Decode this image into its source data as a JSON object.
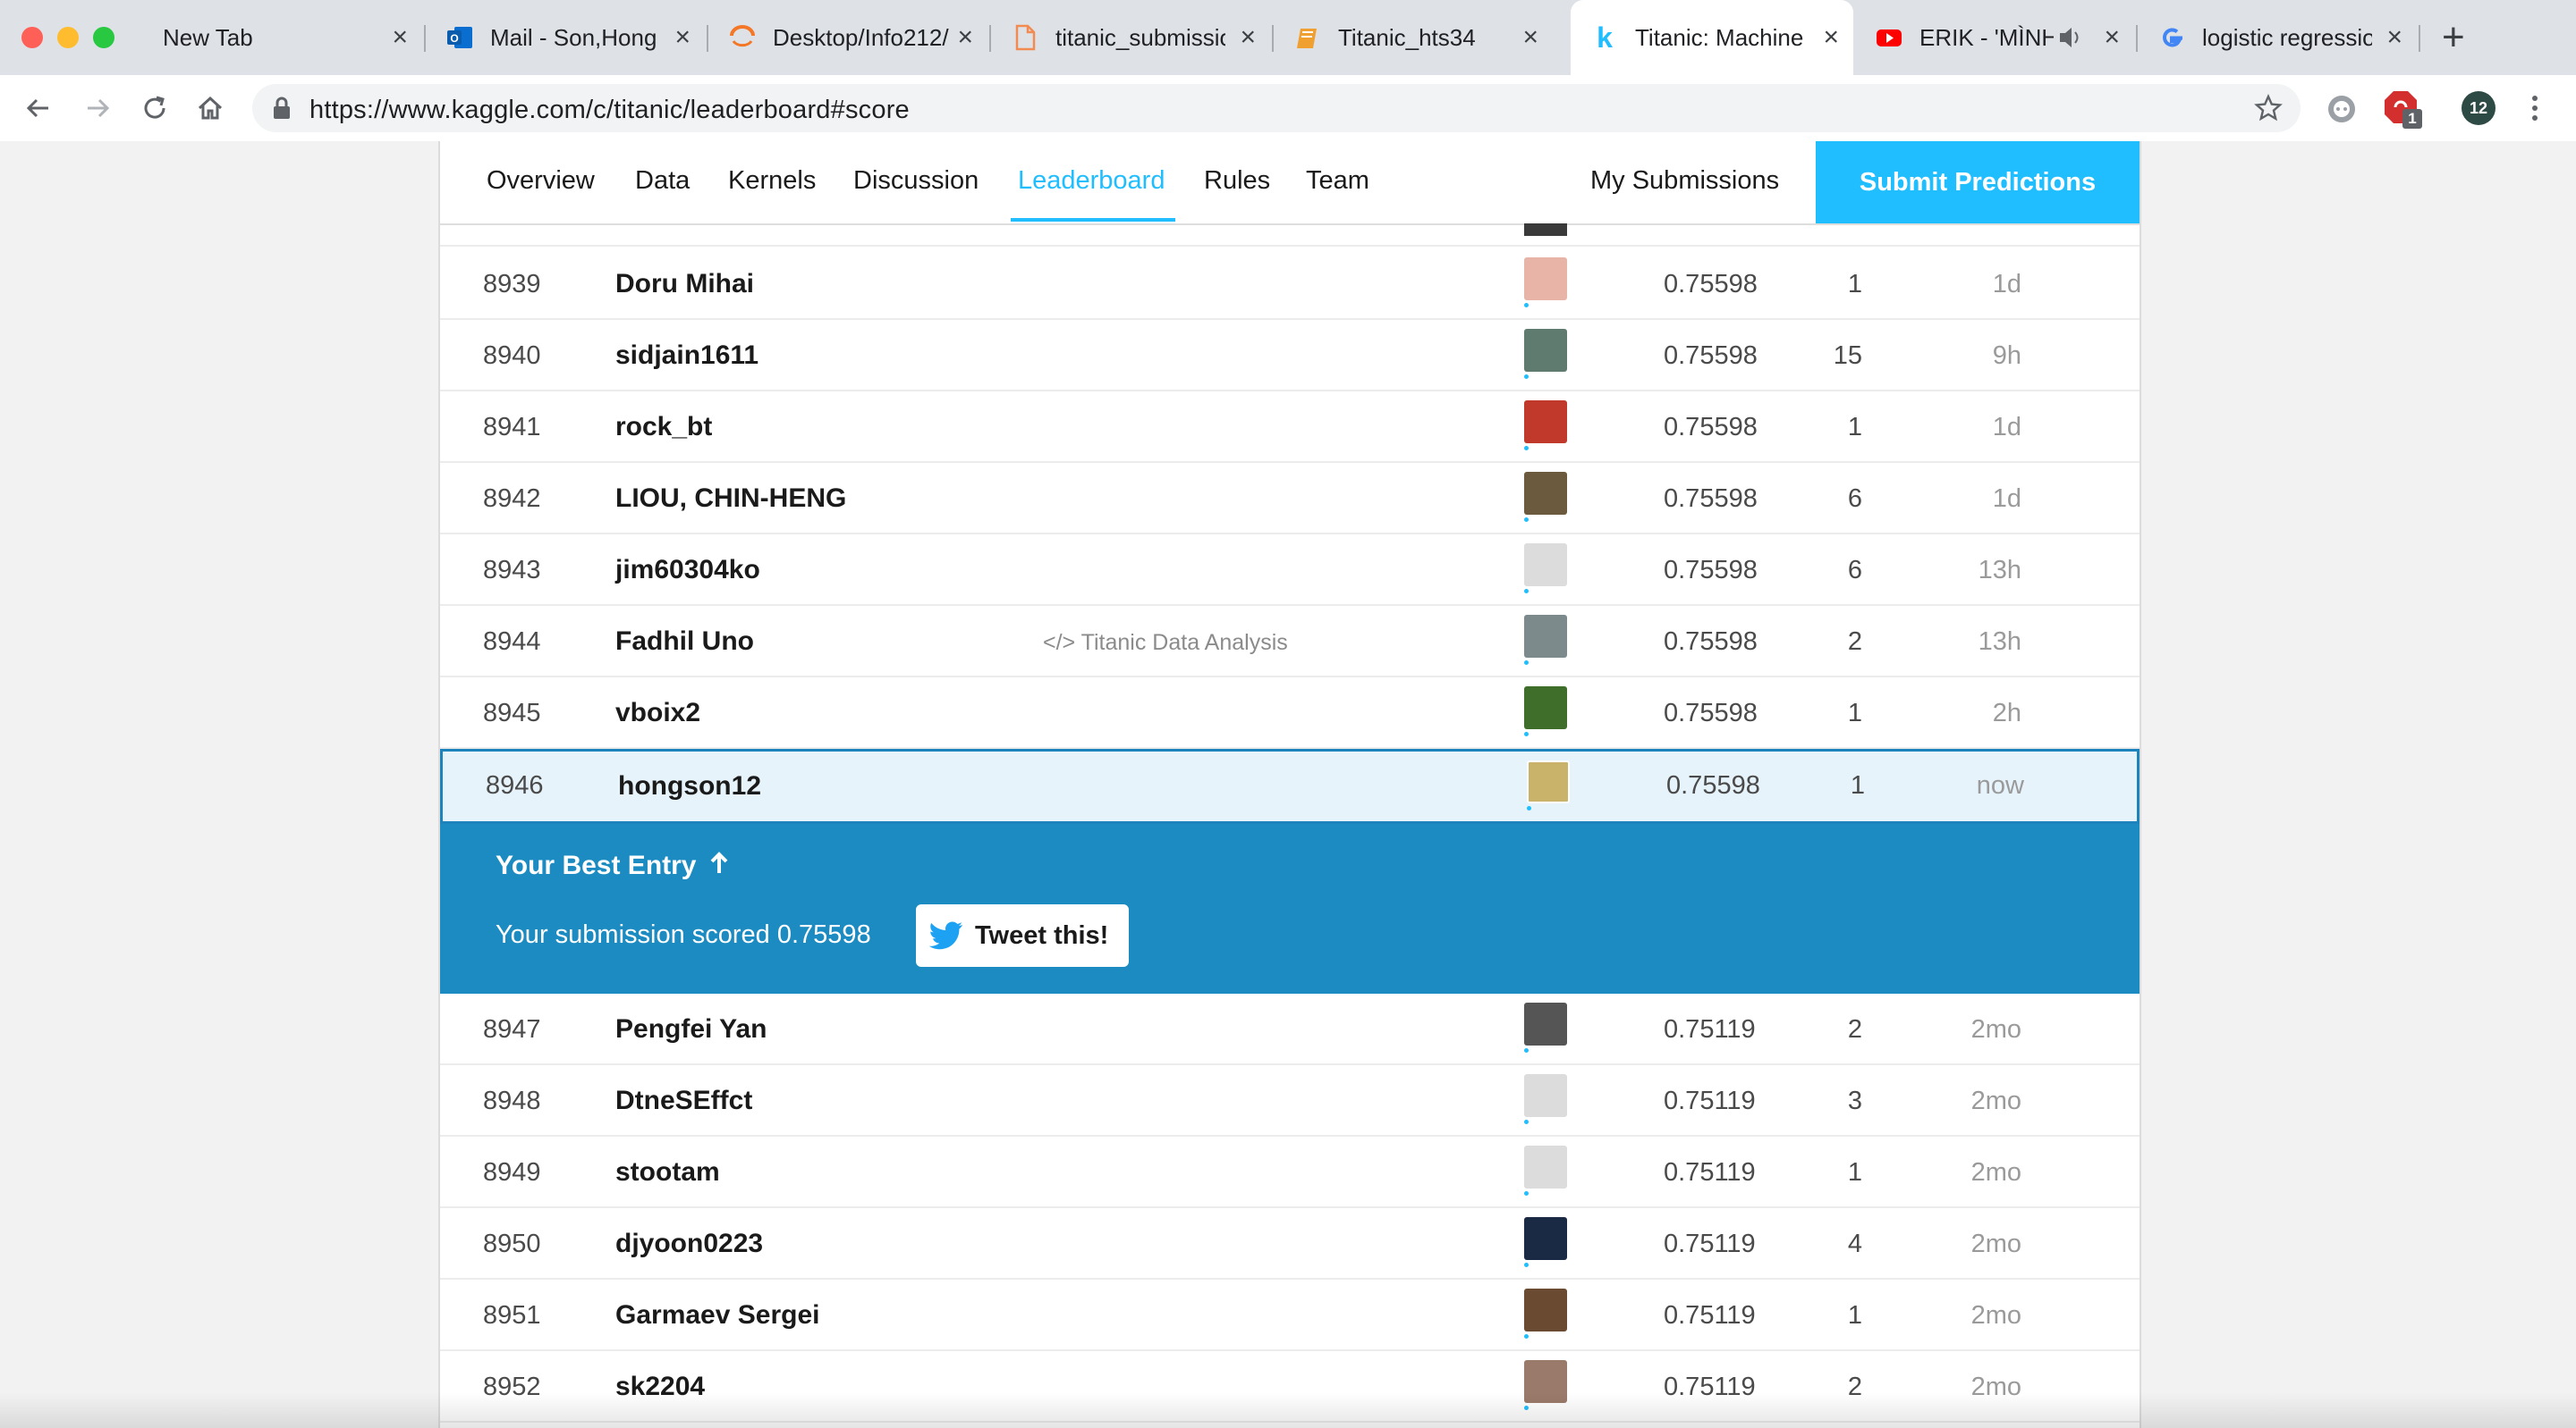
{
  "browser": {
    "tabs": [
      {
        "title": "New Tab",
        "favicon": "none"
      },
      {
        "title": "Mail - Son,Hong",
        "favicon": "outlook-icon"
      },
      {
        "title": "Desktop/Info212/",
        "favicon": "jupyter-icon"
      },
      {
        "title": "titanic_submissio",
        "favicon": "file-icon"
      },
      {
        "title": "Titanic_hts34",
        "favicon": "notebook-icon"
      },
      {
        "title": "Titanic: Machine",
        "favicon": "kaggle-icon",
        "active": true
      },
      {
        "title": "ERIK - 'MÌNH",
        "favicon": "youtube-icon",
        "audio": true
      },
      {
        "title": "logistic regressio",
        "favicon": "google-icon"
      }
    ],
    "new_tab_label": "+",
    "url": "https://www.kaggle.com/c/titanic/leaderboard#score",
    "extension_badge": "1",
    "profile_initials": "12"
  },
  "nav": {
    "items": [
      "Overview",
      "Data",
      "Kernels",
      "Discussion",
      "Leaderboard",
      "Rules",
      "Team"
    ],
    "active": "Leaderboard",
    "my_submissions": "My Submissions",
    "submit": "Submit Predictions"
  },
  "rows_before": [
    {
      "rank": "8939",
      "name": "Doru Mihai",
      "kernel": "",
      "score": "0.75598",
      "entries": "1",
      "last": "1d",
      "avatar": "#e8b4a8"
    },
    {
      "rank": "8940",
      "name": "sidjain1611",
      "kernel": "",
      "score": "0.75598",
      "entries": "15",
      "last": "9h",
      "avatar": "#5f7a6e"
    },
    {
      "rank": "8941",
      "name": "rock_bt",
      "kernel": "",
      "score": "0.75598",
      "entries": "1",
      "last": "1d",
      "avatar": "#c0392b"
    },
    {
      "rank": "8942",
      "name": "LIOU, CHIN-HENG",
      "kernel": "",
      "score": "0.75598",
      "entries": "6",
      "last": "1d",
      "avatar": "#6b5a3e"
    },
    {
      "rank": "8943",
      "name": "jim60304ko",
      "kernel": "",
      "score": "0.75598",
      "entries": "6",
      "last": "13h",
      "avatar": "#dcdcdc"
    },
    {
      "rank": "8944",
      "name": "Fadhil Uno",
      "kernel": "</> Titanic Data Analysis",
      "score": "0.75598",
      "entries": "2",
      "last": "13h",
      "avatar": "#7d8a8c"
    },
    {
      "rank": "8945",
      "name": "vboix2",
      "kernel": "",
      "score": "0.75598",
      "entries": "1",
      "last": "2h",
      "avatar": "#3f6e2a"
    }
  ],
  "my_row": {
    "rank": "8946",
    "name": "hongson12",
    "score": "0.75598",
    "entries": "1",
    "last": "now",
    "avatar": "#c9b36a"
  },
  "best_entry": {
    "title": "Your Best Entry",
    "message": "Your submission scored 0.75598",
    "tweet_label": "Tweet this!"
  },
  "rows_after": [
    {
      "rank": "8947",
      "name": "Pengfei Yan",
      "score": "0.75119",
      "entries": "2",
      "last": "2mo",
      "avatar": "#555555"
    },
    {
      "rank": "8948",
      "name": "DtneSEffct",
      "score": "0.75119",
      "entries": "3",
      "last": "2mo",
      "avatar": "#dcdcdc"
    },
    {
      "rank": "8949",
      "name": "stootam",
      "score": "0.75119",
      "entries": "1",
      "last": "2mo",
      "avatar": "#dcdcdc"
    },
    {
      "rank": "8950",
      "name": "djyoon0223",
      "score": "0.75119",
      "entries": "4",
      "last": "2mo",
      "avatar": "#1a2a44"
    },
    {
      "rank": "8951",
      "name": "Garmaev Sergei",
      "score": "0.75119",
      "entries": "1",
      "last": "2mo",
      "avatar": "#6a4a30"
    },
    {
      "rank": "8952",
      "name": "sk2204",
      "score": "0.75119",
      "entries": "2",
      "last": "2mo",
      "avatar": "#9a7a6a"
    }
  ]
}
